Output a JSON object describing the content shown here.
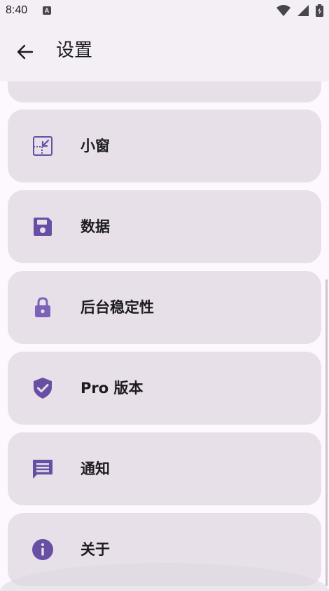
{
  "status_bar": {
    "time": "8:40",
    "notification_letter": "A",
    "icons": [
      "wifi-icon",
      "signal-icon",
      "battery-icon"
    ]
  },
  "app_bar": {
    "back_icon": "arrow-left-icon",
    "title": "设置"
  },
  "items": [
    {
      "label": "小窗",
      "icon": "picture-in-picture-icon"
    },
    {
      "label": "数据",
      "icon": "floppy-disk-icon"
    },
    {
      "label": "后台稳定性",
      "icon": "lock-icon"
    },
    {
      "label": "Pro 版本",
      "icon": "shield-check-icon"
    },
    {
      "label": "通知",
      "icon": "message-icon"
    },
    {
      "label": "关于",
      "icon": "info-icon"
    }
  ],
  "colors": {
    "accent": "#6750a4",
    "card_background": "#e7e0e8",
    "app_bar_background": "#f3eff5",
    "page_background": "#fdf8fd",
    "text": "#1d1b20"
  }
}
